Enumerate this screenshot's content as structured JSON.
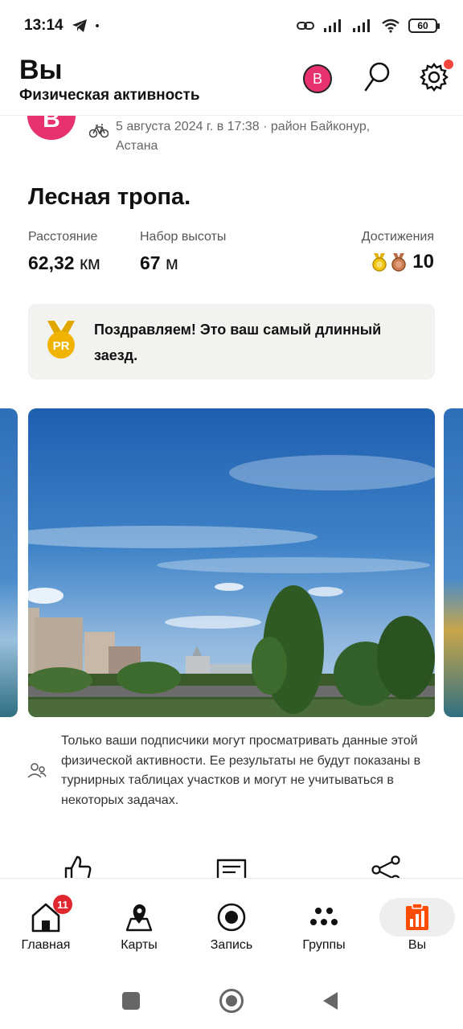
{
  "status_bar": {
    "time": "13:14",
    "battery": "60"
  },
  "header": {
    "title": "Вы",
    "subtitle": "Физическая активность",
    "avatar_letter": "B"
  },
  "activity": {
    "avatar_letter": "B",
    "meta": "5 августа 2024 г. в 17:38 · район Байконур, Астана",
    "title": "Лесная тропа.",
    "stats": {
      "distance_label": "Расстояние",
      "distance_value": "62,32",
      "distance_unit": "км",
      "elevation_label": "Набор высоты",
      "elevation_value": "67",
      "elevation_unit": "м",
      "achievements_label": "Достижения",
      "achievements_count": "10"
    },
    "pr_message": "Поздравляем! Это ваш самый длинный заезд.",
    "pr_badge": "PR",
    "privacy_note": "Только ваши подписчики могут просматривать данные этой физической активности. Ее результаты не будут показаны в турнирных таблицах участков и могут не учитываться в некоторых задачах."
  },
  "bottom_nav": {
    "items": [
      {
        "label": "Главная",
        "badge": "11"
      },
      {
        "label": "Карты"
      },
      {
        "label": "Запись"
      },
      {
        "label": "Группы"
      },
      {
        "label": "Вы"
      }
    ]
  },
  "colors": {
    "brand": "#fc4c02",
    "avatar": "#e8326f",
    "badge": "#e0262f"
  }
}
